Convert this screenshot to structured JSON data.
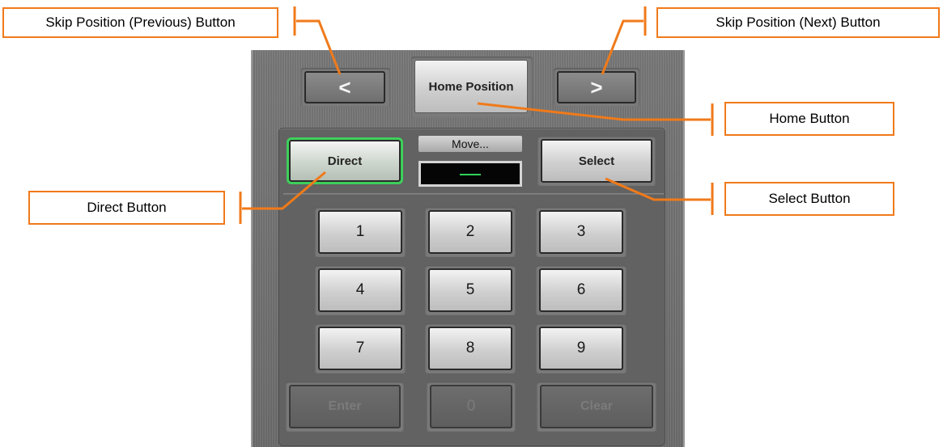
{
  "device": {
    "skip_prev_label": "<",
    "skip_next_label": ">",
    "home_label": "Home Position",
    "direct_label": "Direct",
    "select_label": "Select",
    "move_label": "Move...",
    "move_value": "",
    "keypad": [
      "1",
      "2",
      "3",
      "4",
      "5",
      "6",
      "7",
      "8",
      "9"
    ],
    "enter_label": "Enter",
    "zero_label": "0",
    "clear_label": "Clear"
  },
  "callouts": {
    "skip_prev": "Skip Position (Previous) Button",
    "skip_next": "Skip Position (Next) Button",
    "home": "Home Button",
    "direct": "Direct Button",
    "select": "Select Button"
  },
  "colors": {
    "callout_orange": "#f07a1a",
    "direct_highlight": "#3ecf5b",
    "display_dash": "#2fd15a"
  }
}
